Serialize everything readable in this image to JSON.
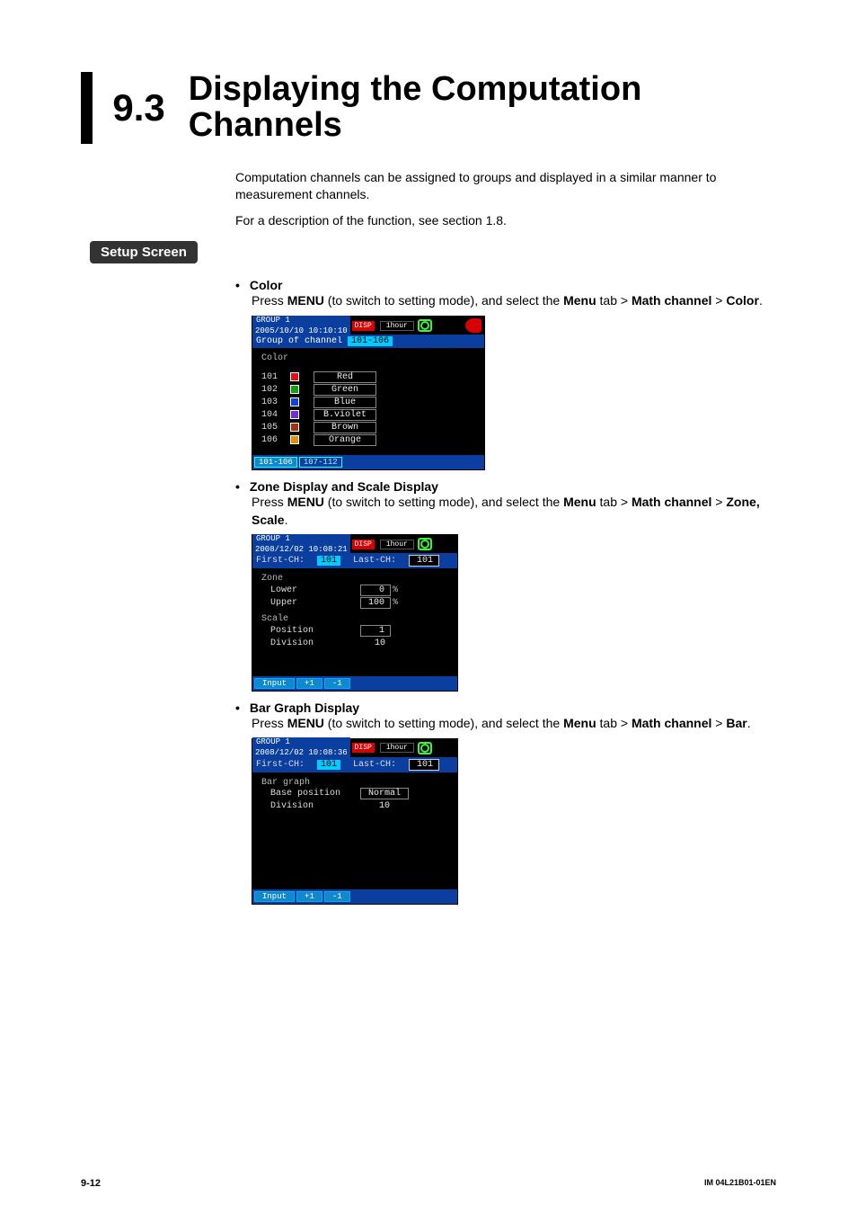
{
  "title": {
    "num": "9.3",
    "text": "Displaying the Computation Channels"
  },
  "intro1": "Computation channels can be assigned to groups and displayed in a similar manner to measurement channels.",
  "intro2": "For a description of the function, see section 1.8.",
  "section_label": "Setup Screen",
  "color": {
    "bullet": "Color",
    "press": "Press ",
    "menu_bold": "MENU",
    "after_menu": " (to switch to setting mode), and select the ",
    "menu_tab_bold": "Menu",
    "gt1": " tab > ",
    "math_bold": "Math channel",
    "gt2": " > ",
    "dest_bold": "Color",
    "dot": ".",
    "shot": {
      "group": "GROUP 1",
      "dt": "2005/10/10 10:10:10",
      "disp": "DISP",
      "hour": "1hour",
      "bar_label": "Group of channel",
      "bar_val": "101-106",
      "heading": "Color",
      "rows": [
        {
          "ch": "101",
          "color": "#e01010",
          "name": "Red"
        },
        {
          "ch": "102",
          "color": "#10a010",
          "name": "Green"
        },
        {
          "ch": "103",
          "color": "#1040e0",
          "name": "Blue"
        },
        {
          "ch": "104",
          "color": "#7030d0",
          "name": "B.violet"
        },
        {
          "ch": "105",
          "color": "#a03010",
          "name": "Brown"
        },
        {
          "ch": "106",
          "color": "#e09010",
          "name": "Orange"
        }
      ],
      "tabs": [
        "101-106",
        "107-112"
      ]
    }
  },
  "zone": {
    "bullet": "Zone Display and Scale Display",
    "press": "Press ",
    "menu_bold": "MENU",
    "after_menu": " (to switch to setting mode), and select the ",
    "menu_tab_bold": "Menu",
    "gt1": " tab > ",
    "math_bold": "Math channel",
    "gt2": " > ",
    "dest_bold": "Zone, Scale",
    "dot": ".",
    "shot": {
      "group": "GROUP 1",
      "dt": "2008/12/02 10:08:21",
      "disp": "DISP",
      "hour": "1hour",
      "first_lbl": "First-CH:",
      "first_val": "101",
      "last_lbl": "Last-CH:",
      "last_val": "101",
      "zone_lbl": "Zone",
      "lower_lbl": "Lower",
      "lower_val": "0",
      "upper_lbl": "Upper",
      "upper_val": "100",
      "pct": "%",
      "scale_lbl": "Scale",
      "pos_lbl": "Position",
      "pos_val": "1",
      "div_lbl": "Division",
      "div_val": "10",
      "btns": [
        "Input",
        "+1",
        "-1"
      ]
    }
  },
  "bar": {
    "bullet": "Bar Graph Display",
    "press": "Press ",
    "menu_bold": "MENU",
    "after_menu": " (to switch to setting mode), and select the ",
    "menu_tab_bold": "Menu",
    "gt1": " tab > ",
    "math_bold": "Math channel",
    "gt2": " > ",
    "dest_bold": "Bar",
    "dot": ".",
    "shot": {
      "group": "GROUP 1",
      "dt": "2008/12/02 10:08:36",
      "disp": "DISP",
      "hour": "1hour",
      "first_lbl": "First-CH:",
      "first_val": "101",
      "last_lbl": "Last-CH:",
      "last_val": "101",
      "sec_lbl": "Bar graph",
      "base_lbl": "Base position",
      "base_val": "Normal",
      "div_lbl": "Division",
      "div_val": "10",
      "btns": [
        "Input",
        "+1",
        "-1"
      ]
    }
  },
  "footer": {
    "page": "9-12",
    "doc": "IM 04L21B01-01EN"
  }
}
